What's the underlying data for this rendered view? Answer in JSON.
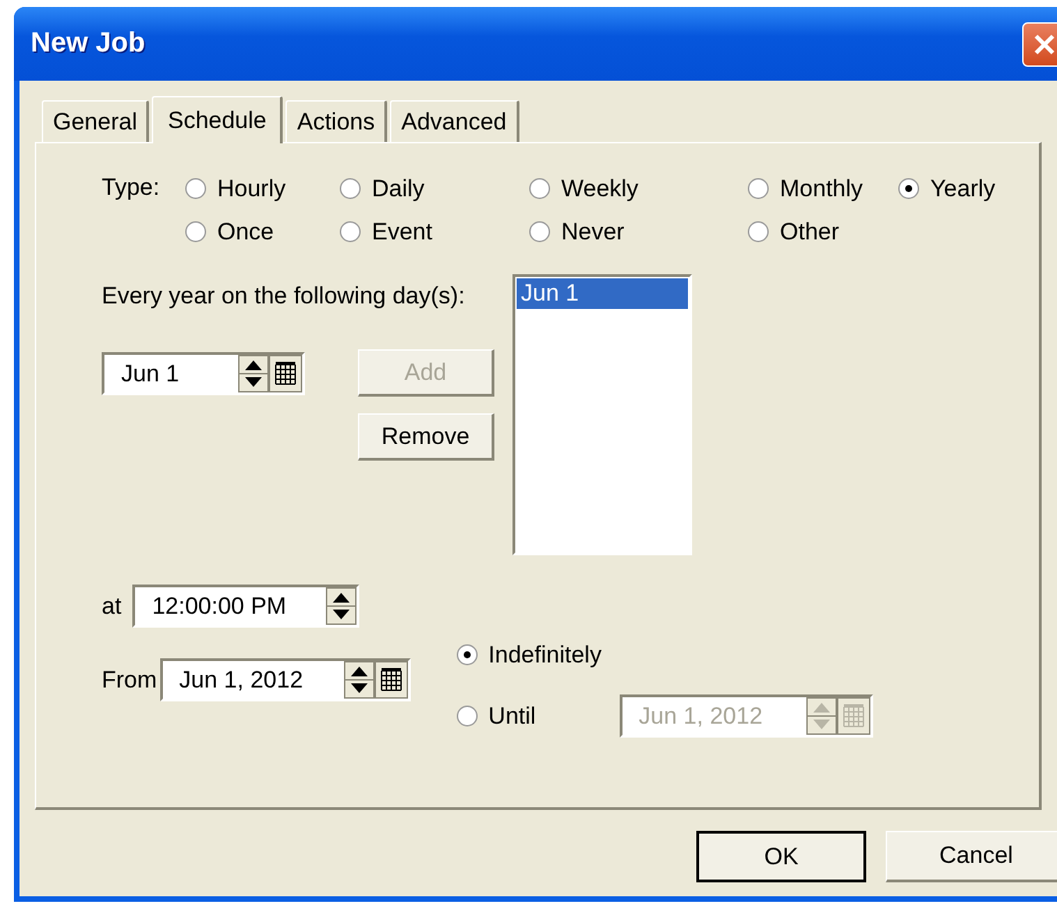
{
  "window": {
    "title": "New Job"
  },
  "tabs": [
    {
      "label": "General",
      "selected": false
    },
    {
      "label": "Schedule",
      "selected": true
    },
    {
      "label": "Actions",
      "selected": false
    },
    {
      "label": "Advanced",
      "selected": false
    }
  ],
  "schedule": {
    "type_label": "Type:",
    "type_options": [
      {
        "label": "Hourly",
        "selected": false
      },
      {
        "label": "Daily",
        "selected": false
      },
      {
        "label": "Weekly",
        "selected": false
      },
      {
        "label": "Monthly",
        "selected": false
      },
      {
        "label": "Yearly",
        "selected": true
      },
      {
        "label": "Once",
        "selected": false
      },
      {
        "label": "Event",
        "selected": false
      },
      {
        "label": "Never",
        "selected": false
      },
      {
        "label": "Other",
        "selected": false
      }
    ],
    "days_label": "Every year on the following day(s):",
    "day_field": {
      "value": "Jun 1"
    },
    "day_buttons": [
      {
        "label": "Add",
        "disabled": true
      },
      {
        "label": "Remove",
        "disabled": false
      }
    ],
    "days_list": [
      {
        "label": "Jun 1",
        "selected": true
      }
    ],
    "time_label": "at",
    "time_field": {
      "value": "12:00:00 PM"
    },
    "from_label": "From",
    "from_field": {
      "value": "Jun 1, 2012"
    },
    "end_options": [
      {
        "label": "Indefinitely",
        "selected": true
      },
      {
        "label": "Until",
        "selected": false
      }
    ],
    "until_field": {
      "value": "Jun 1, 2012",
      "disabled": true
    }
  },
  "buttons": [
    {
      "label": "OK",
      "default": true
    },
    {
      "label": "Cancel",
      "default": false
    }
  ]
}
